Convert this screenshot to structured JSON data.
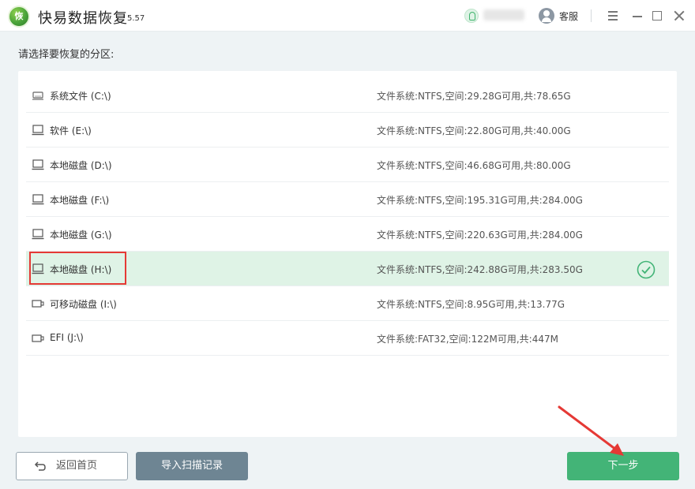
{
  "app": {
    "logo_text": "恢",
    "title": "快易数据恢复",
    "version": "5.57",
    "customer_service": "客服"
  },
  "prompt": "请选择要恢复的分区:",
  "partitions": [
    {
      "name": "系统文件 (C:\\)",
      "info": "文件系统:NTFS,空间:29.28G可用,共:78.65G",
      "icon": "hard-drive-icon",
      "selected": false
    },
    {
      "name": "软件 (E:\\)",
      "info": "文件系统:NTFS,空间:22.80G可用,共:40.00G",
      "icon": "laptop-drive-icon",
      "selected": false
    },
    {
      "name": "本地磁盘 (D:\\)",
      "info": "文件系统:NTFS,空间:46.68G可用,共:80.00G",
      "icon": "laptop-drive-icon",
      "selected": false
    },
    {
      "name": "本地磁盘 (F:\\)",
      "info": "文件系统:NTFS,空间:195.31G可用,共:284.00G",
      "icon": "laptop-drive-icon",
      "selected": false
    },
    {
      "name": "本地磁盘 (G:\\)",
      "info": "文件系统:NTFS,空间:220.63G可用,共:284.00G",
      "icon": "laptop-drive-icon",
      "selected": false
    },
    {
      "name": "本地磁盘 (H:\\)",
      "info": "文件系统:NTFS,空间:242.88G可用,共:283.50G",
      "icon": "laptop-drive-icon",
      "selected": true
    },
    {
      "name": "可移动磁盘 (I:\\)",
      "info": "文件系统:NTFS,空间:8.95G可用,共:13.77G",
      "icon": "usb-drive-icon",
      "selected": false
    },
    {
      "name": "EFI (J:\\)",
      "info": "文件系统:FAT32,空间:122M可用,共:447M",
      "icon": "usb-drive-icon",
      "selected": false
    }
  ],
  "buttons": {
    "home": "返回首页",
    "import": "导入扫描记录",
    "next": "下一步"
  },
  "colors": {
    "accent": "#43b477",
    "selected_row": "#dff3e6",
    "annotation": "#e53935"
  }
}
